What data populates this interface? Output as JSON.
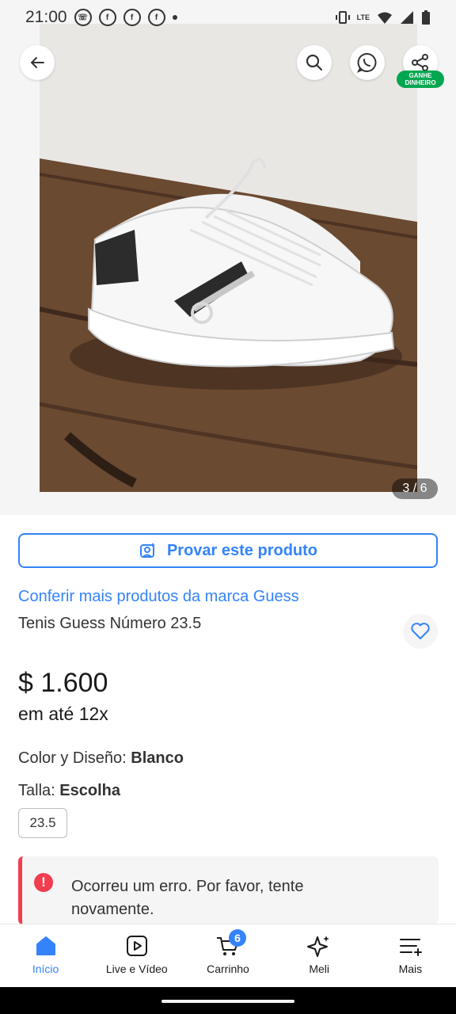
{
  "status": {
    "time": "21:00",
    "lte_label": "LTE",
    "icons": [
      "whatsapp-icon",
      "facebook-icon",
      "facebook-icon",
      "facebook-icon",
      "dot-icon",
      "vibrate-icon",
      "wifi-icon",
      "signal-icon",
      "battery-icon"
    ]
  },
  "gallery": {
    "counter": "3 / 6",
    "share_badge": "GANHE DINHEIRO"
  },
  "product": {
    "try_button": "Provar este produto",
    "brand_link": "Conferir mais produtos da marca Guess",
    "title": "Tenis Guess Número 23.5",
    "price": "$ 1.600",
    "installments": "em até 12x",
    "color_label": "Color y Diseño:",
    "color_value": "Blanco",
    "size_label": "Talla:",
    "size_value": "Escolha",
    "size_chip": "23.5"
  },
  "error": {
    "icon": "!",
    "message": "Ocorreu um erro. Por favor, tente novamente."
  },
  "nav": {
    "items": [
      {
        "label": "Início",
        "icon": "home-icon"
      },
      {
        "label": "Live e Vídeo",
        "icon": "video-icon"
      },
      {
        "label": "Carrinho",
        "icon": "cart-icon"
      },
      {
        "label": "Meli",
        "icon": "sparkle-icon"
      },
      {
        "label": "Mais",
        "icon": "menu-icon"
      }
    ],
    "cart_count": "6"
  },
  "colors": {
    "accent": "#3483fa",
    "error": "#f23d4f",
    "success": "#00a650"
  }
}
